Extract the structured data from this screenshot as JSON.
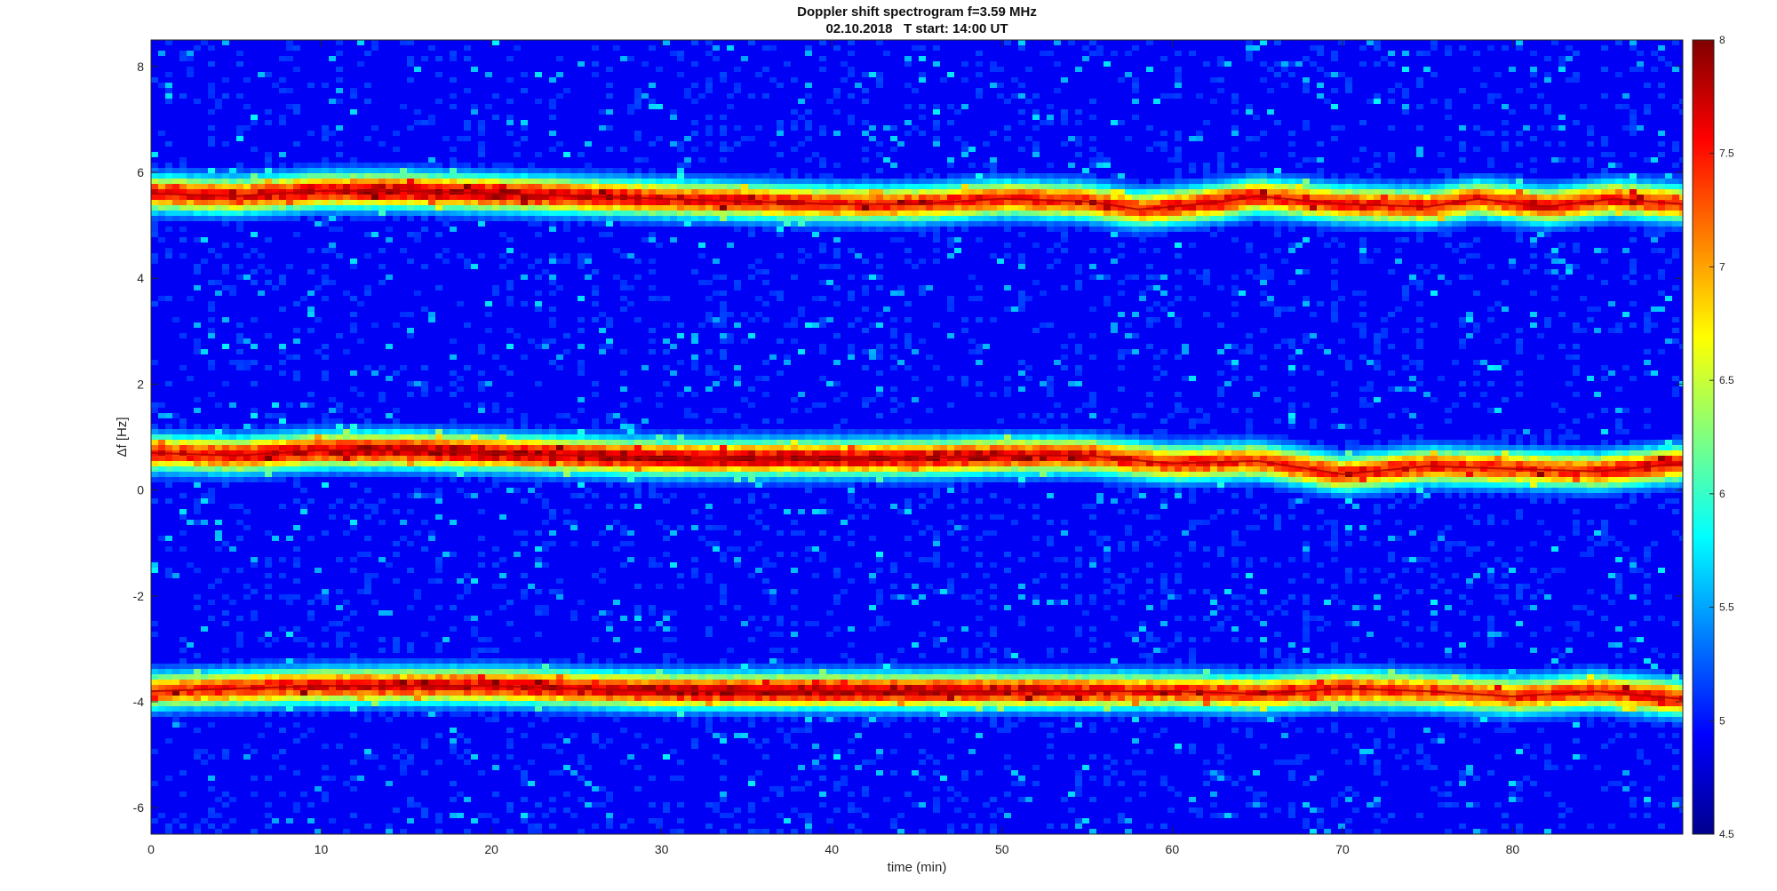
{
  "chart_data": {
    "type": "heatmap",
    "title": "Doppler shift spectrogram f=3.59 MHz",
    "subtitle": "02.10.2018   T start: 14:00 UT",
    "xlabel": "time (min)",
    "ylabel": "Δf [Hz]",
    "xlim": [
      0,
      90
    ],
    "ylim": [
      -6.5,
      8.5
    ],
    "xticks": [
      0,
      10,
      20,
      30,
      40,
      50,
      60,
      70,
      80
    ],
    "yticks": [
      -6,
      -4,
      -2,
      0,
      2,
      4,
      6,
      8
    ],
    "colorbar": {
      "colormap": "jet",
      "clim": [
        4.5,
        8
      ],
      "ticks": [
        4.5,
        5,
        5.5,
        6,
        6.5,
        7,
        7.5,
        8
      ]
    },
    "traces": [
      {
        "time": [
          0,
          5,
          10,
          15,
          20,
          25,
          30,
          35,
          40,
          45,
          50,
          55,
          58,
          60,
          63,
          65,
          70,
          75,
          78,
          82,
          86,
          90
        ],
        "freq": [
          5.6,
          5.55,
          5.65,
          5.65,
          5.6,
          5.55,
          5.5,
          5.45,
          5.4,
          5.4,
          5.5,
          5.45,
          5.3,
          5.35,
          5.45,
          5.55,
          5.4,
          5.35,
          5.5,
          5.35,
          5.5,
          5.4
        ],
        "peak_level": [
          7.6,
          7.6,
          7.7,
          7.8,
          7.8,
          7.7,
          7.6,
          7.6,
          7.5,
          7.5,
          7.5,
          7.5,
          7.4,
          7.5,
          7.6,
          7.5,
          7.5,
          7.5,
          7.5,
          7.6,
          7.5,
          7.5
        ]
      },
      {
        "time": [
          0,
          5,
          10,
          15,
          20,
          25,
          30,
          35,
          40,
          45,
          50,
          55,
          60,
          65,
          70,
          75,
          80,
          85,
          90
        ],
        "freq": [
          0.7,
          0.65,
          0.75,
          0.75,
          0.7,
          0.65,
          0.6,
          0.6,
          0.6,
          0.6,
          0.65,
          0.65,
          0.5,
          0.55,
          0.3,
          0.45,
          0.4,
          0.35,
          0.5
        ],
        "peak_level": [
          7.5,
          7.6,
          7.7,
          7.8,
          7.8,
          7.8,
          7.8,
          7.8,
          7.8,
          7.8,
          7.7,
          7.6,
          7.5,
          7.4,
          7.5,
          7.5,
          7.4,
          7.5,
          7.6
        ]
      },
      {
        "time": [
          0,
          5,
          10,
          15,
          20,
          25,
          30,
          35,
          40,
          45,
          50,
          55,
          60,
          65,
          70,
          75,
          80,
          85,
          90
        ],
        "freq": [
          -3.8,
          -3.75,
          -3.7,
          -3.7,
          -3.7,
          -3.75,
          -3.8,
          -3.8,
          -3.8,
          -3.8,
          -3.8,
          -3.8,
          -3.8,
          -3.85,
          -3.75,
          -3.8,
          -3.9,
          -3.8,
          -3.95
        ],
        "peak_level": [
          7.4,
          7.5,
          7.6,
          7.6,
          7.7,
          7.7,
          7.8,
          7.8,
          7.8,
          7.8,
          7.7,
          7.6,
          7.5,
          7.5,
          7.5,
          7.4,
          7.4,
          7.5,
          7.5
        ]
      }
    ],
    "background_level": 4.9
  }
}
